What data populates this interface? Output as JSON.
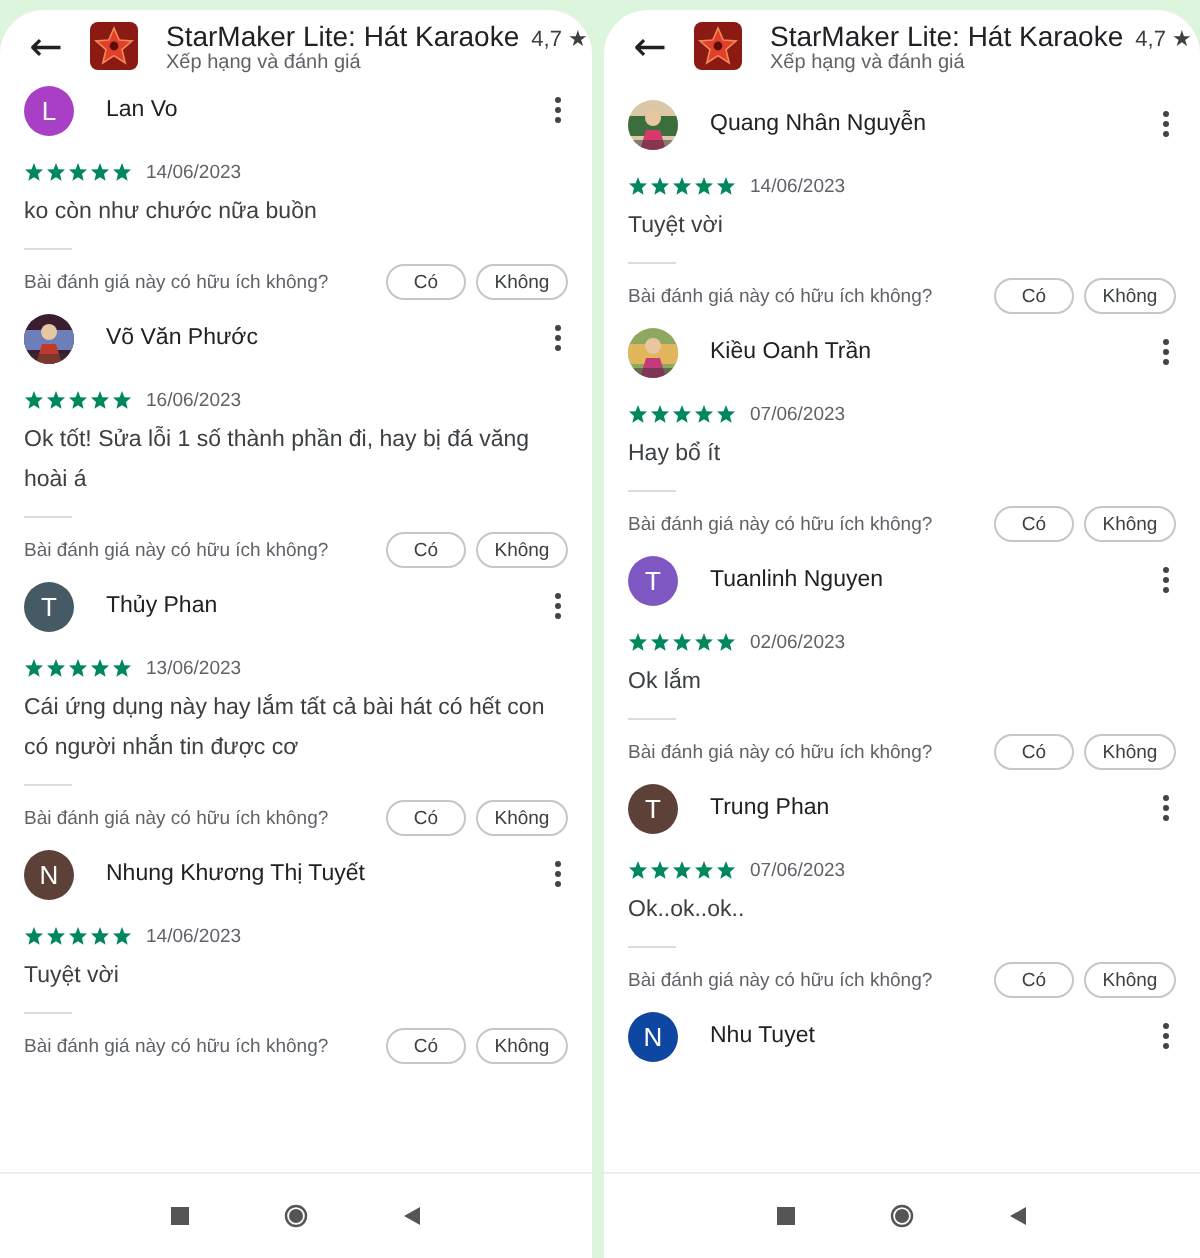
{
  "panels": [
    {
      "header": {
        "back": "←",
        "title": "StarMaker Lite: Hát Karaoke",
        "rating": "4,7",
        "rating_star": "★",
        "subtitle": "Xếp hạng và đánh giá"
      },
      "reviews": [
        {
          "name": "Lan Vo",
          "avatar": {
            "kind": "letter",
            "letter": "L",
            "color": "#a83fc4"
          },
          "stars": 5,
          "date": "14/06/2023",
          "text": "ko còn như chước nữa buồn",
          "helpful": "Bài đánh giá này có hữu ích không?",
          "yes": "Có",
          "no": "Không"
        },
        {
          "name": "Võ Văn Phước",
          "stars": 5,
          "date": "16/06/2023",
          "text": "Ok tốt! Sửa lỗi 1 số thành phần đi, hay bị đá văng hoài á",
          "helpful": "Bài đánh giá này có hữu ích không?",
          "yes": "Có",
          "no": "Không"
        },
        {
          "name": "Thủy Phan",
          "avatar": {
            "kind": "letter",
            "letter": "T",
            "color": "#455a64"
          },
          "stars": 5,
          "date": "13/06/2023",
          "text": "Cái ứng dụng này hay lắm tất cả bài hát có hết con có người nhắn tin được cơ",
          "helpful": "Bài đánh giá này có hữu ích không?",
          "yes": "Có",
          "no": "Không"
        },
        {
          "name": "Nhung Khương Thị Tuyết",
          "avatar": {
            "kind": "letter",
            "letter": "N",
            "color": "#5d4037"
          },
          "stars": 5,
          "date": "14/06/2023",
          "text": "Tuyệt vời",
          "helpful": "Bài đánh giá này có hữu ích không?",
          "yes": "Có",
          "no": "Không"
        }
      ]
    },
    {
      "header": {
        "back": "←",
        "title": "StarMaker Lite: Hát Karaoke",
        "rating": "4,7",
        "rating_star": "★",
        "subtitle": "Xếp hạng và đánh giá"
      },
      "reviews": [
        {
          "name": "Quang Nhân Nguyễn",
          "stars": 5,
          "date": "14/06/2023",
          "text": "Tuyệt vời",
          "helpful": "Bài đánh giá này có hữu ích không?",
          "yes": "Có",
          "no": "Không"
        },
        {
          "name": "Kiều Oanh Trần",
          "stars": 5,
          "date": "07/06/2023",
          "text": "Hay bổ ít",
          "helpful": "Bài đánh giá này có hữu ích không?",
          "yes": "Có",
          "no": "Không"
        },
        {
          "name": "Tuanlinh Nguyen",
          "avatar": {
            "kind": "letter",
            "letter": "T",
            "color": "#7e57c2"
          },
          "stars": 5,
          "date": "02/06/2023",
          "text": "Ok lắm",
          "helpful": "Bài đánh giá này có hữu ích không?",
          "yes": "Có",
          "no": "Không"
        },
        {
          "name": "Trung Phan",
          "avatar": {
            "kind": "letter",
            "letter": "T",
            "color": "#5d4037"
          },
          "stars": 5,
          "date": "07/06/2023",
          "text": "Ok..ok..ok..",
          "helpful": "Bài đánh giá này có hữu ích không?",
          "yes": "Có",
          "no": "Không"
        },
        {
          "name": "Nhu Tuyet",
          "avatar": {
            "kind": "letter",
            "letter": "N",
            "color": "#0d47a1"
          }
        }
      ]
    }
  ]
}
